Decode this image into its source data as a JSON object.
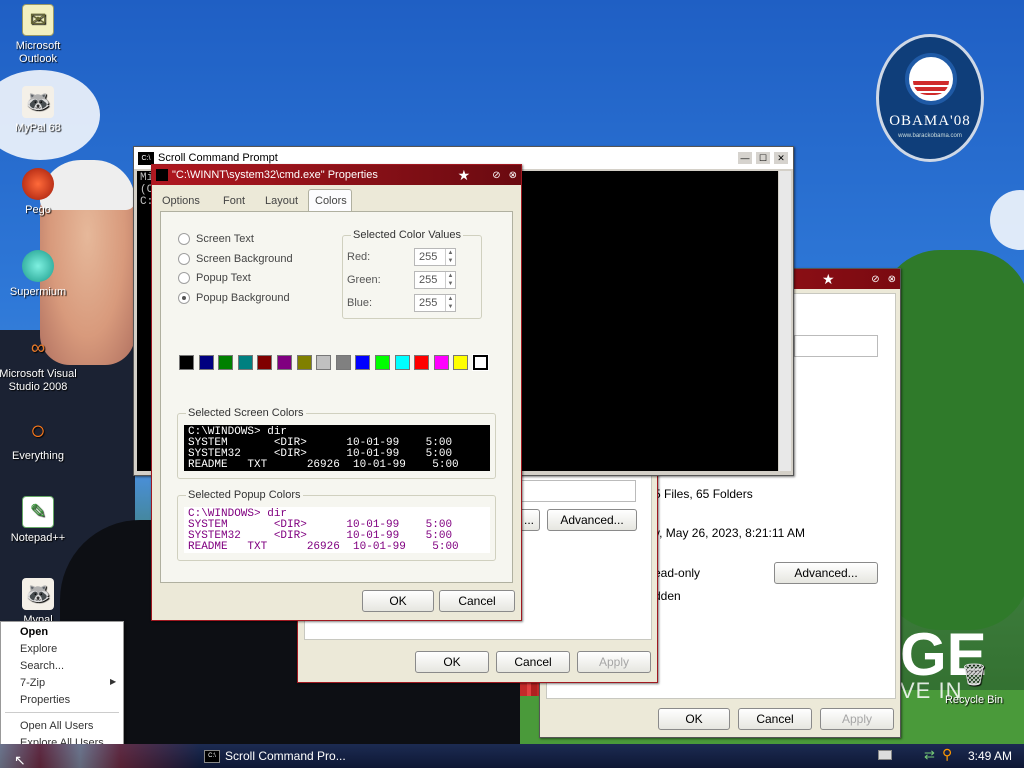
{
  "desktop": {
    "icons": [
      {
        "label": "Microsoft Outlook",
        "icon": "outlook-icon"
      },
      {
        "label": "MyPal 68",
        "icon": "mypal-icon"
      },
      {
        "label": "Pego",
        "icon": "pego-icon"
      },
      {
        "label": "Supermium",
        "icon": "supermium-icon"
      },
      {
        "label": "Microsoft Visual Studio 2008",
        "icon": "visual-studio-icon"
      },
      {
        "label": "Everything",
        "icon": "everything-icon"
      },
      {
        "label": "Notepad++",
        "icon": "notepadpp-icon"
      },
      {
        "label": "Mypal",
        "icon": "mypal-icon"
      }
    ],
    "recycle_bin": "Recycle Bin",
    "wallpaper": {
      "badge_text": "OBAMA'08",
      "badge_sub": "www.barackobama.com",
      "big_text": "GE",
      "sub_text": "VE IN"
    }
  },
  "cmd_window": {
    "title": "Scroll Command Prompt",
    "text_lines": [
      "Mi",
      "(C",
      "",
      "C:"
    ]
  },
  "properties_dialog": {
    "title": "\"C:\\WINNT\\system32\\cmd.exe\" Properties",
    "tabs": [
      "Options",
      "Font",
      "Layout",
      "Colors"
    ],
    "active_tab": "Colors",
    "radios": [
      {
        "label": "Screen Text",
        "selected": false
      },
      {
        "label": "Screen Background",
        "selected": false
      },
      {
        "label": "Popup Text",
        "selected": false
      },
      {
        "label": "Popup Background",
        "selected": true
      }
    ],
    "color_values_group": "Selected Color Values",
    "red_label": "Red:",
    "red_value": "255",
    "green_label": "Green:",
    "green_value": "255",
    "blue_label": "Blue:",
    "blue_value": "255",
    "palette": [
      "#000000",
      "#000080",
      "#008000",
      "#008080",
      "#800000",
      "#800080",
      "#808000",
      "#c0c0c0",
      "#808080",
      "#0000ff",
      "#00ff00",
      "#00ffff",
      "#ff0000",
      "#ff00ff",
      "#ffff00",
      "#ffffff"
    ],
    "screen_colors_group": "Selected Screen Colors",
    "screen_preview": [
      "C:\\WINDOWS> dir",
      "SYSTEM       <DIR>      10-01-99    5:00",
      "SYSTEM32     <DIR>      10-01-99    5:00",
      "README   TXT      26926  10-01-99    5:00"
    ],
    "popup_colors_group": "Selected Popup Colors",
    "popup_preview": [
      "C:\\WINDOWS> dir",
      "SYSTEM       <DIR>      10-01-99    5:00",
      "SYSTEM32     <DIR>      10-01-99    5:00",
      "README   TXT      26926  10-01-99    5:00"
    ],
    "ok": "OK",
    "cancel": "Cancel"
  },
  "mid_dialog": {
    "advanced": "Advanced...",
    "ok": "OK",
    "cancel": "Cancel",
    "apply": "Apply",
    "ellipsis": "..."
  },
  "back_dialog": {
    "contains": "5 Files, 65 Folders",
    "created": "y, May 26, 2023, 8:21:11 AM",
    "readonly": "ead-only",
    "hidden": "dden",
    "advanced": "Advanced...",
    "ok": "OK",
    "cancel": "Cancel",
    "apply": "Apply"
  },
  "context_menu": {
    "items": [
      "Open",
      "Explore",
      "Search...",
      "7-Zip",
      "Properties",
      "Open All Users",
      "Explore All Users"
    ]
  },
  "taskbar": {
    "task_label": "Scroll Command Pro...",
    "clock": "3:49 AM"
  }
}
